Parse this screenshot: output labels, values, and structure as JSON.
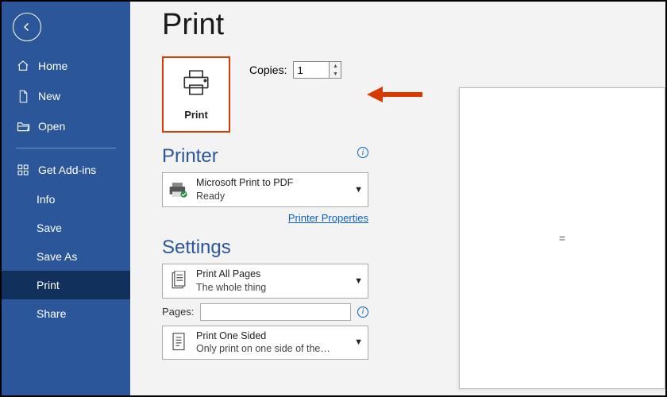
{
  "sidebar": {
    "items": [
      {
        "label": "Home"
      },
      {
        "label": "New"
      },
      {
        "label": "Open"
      },
      {
        "label": "Get Add-ins"
      },
      {
        "label": "Info"
      },
      {
        "label": "Save"
      },
      {
        "label": "Save As"
      },
      {
        "label": "Print"
      },
      {
        "label": "Share"
      }
    ]
  },
  "page": {
    "title": "Print",
    "print_button_label": "Print",
    "copies_label": "Copies:",
    "copies_value": "1"
  },
  "printer": {
    "heading": "Printer",
    "name": "Microsoft Print to PDF",
    "status": "Ready",
    "properties_link": "Printer Properties"
  },
  "settings": {
    "heading": "Settings",
    "pages_label": "Pages:",
    "pages_value": "",
    "scope": {
      "title": "Print All Pages",
      "sub": "The whole thing"
    },
    "sides": {
      "title": "Print One Sided",
      "sub": "Only print on one side of the…"
    }
  },
  "preview": {
    "placeholder": "="
  }
}
